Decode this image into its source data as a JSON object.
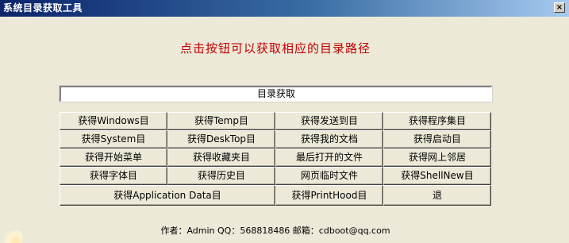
{
  "window": {
    "title": "系统目录获取工具",
    "close_glyph": "×"
  },
  "headline": "点击按钮可以获取相应的目录路径",
  "path_display": "目录获取",
  "buttons": {
    "windows": "获得Windows目",
    "temp": "获得Temp目",
    "sendto": "获得发送到目",
    "programs": "获得程序集目",
    "system": "获得System目",
    "desktop": "获得DeskTop目",
    "mydocs": "获得我的文档",
    "startup": "获得启动目",
    "startmenu": "获得开始菜单",
    "favorites": "获得收藏夹目",
    "recent": "最后打开的文件",
    "nethood": "获得网上邻居",
    "fonts": "获得字体目",
    "history": "获得历史目",
    "tempinet": "网页临时文件",
    "shellnew": "获得ShellNew目",
    "appdata": "获得Application Data目",
    "printhood": "获得PrintHood目",
    "exit": "退"
  },
  "footer": "作者：Admin  QQ：568818486  邮箱：cdboot@qq.com"
}
